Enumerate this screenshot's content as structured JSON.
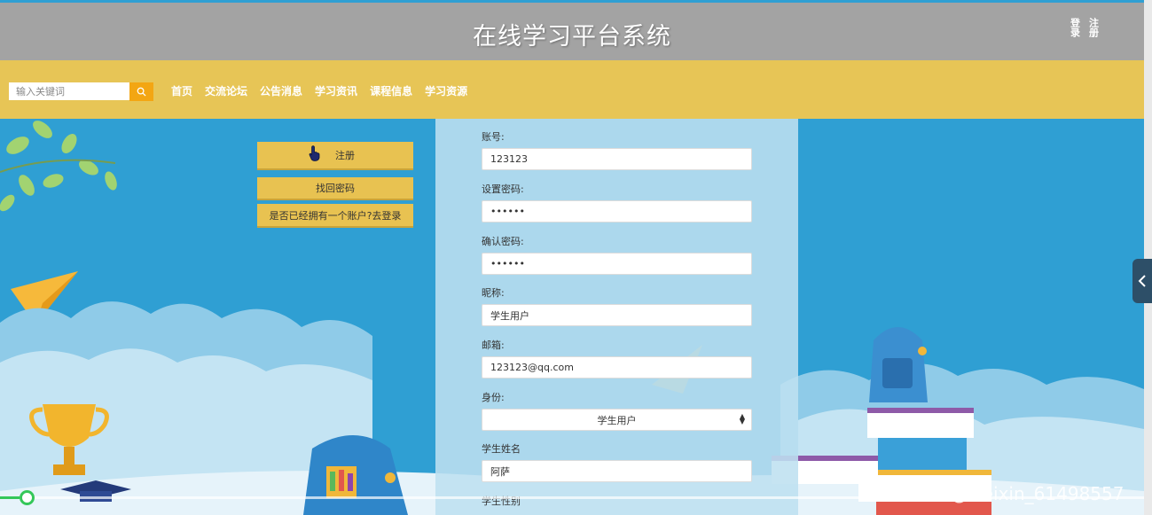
{
  "header": {
    "title": "在线学习平台系统",
    "login_label": "登录",
    "register_label": "注册"
  },
  "nav": {
    "search_placeholder": "输入关键词",
    "items": [
      "首页",
      "交流论坛",
      "公告消息",
      "学习资讯",
      "课程信息",
      "学习资源"
    ]
  },
  "actions": {
    "register": "注册",
    "forgot_password": "找回密码",
    "have_account": "是否已经拥有一个账户?去登录"
  },
  "form": {
    "account_label": "账号:",
    "account_value": "123123",
    "password_label": "设置密码:",
    "password_value": "123123",
    "confirm_label": "确认密码:",
    "confirm_value": "123123",
    "nickname_label": "昵称:",
    "nickname_value": "学生用户",
    "email_label": "邮箱:",
    "email_value": "123123@qq.com",
    "identity_label": "身份:",
    "identity_value": "学生用户",
    "student_name_label": "学生姓名",
    "student_name_value": "阿萨",
    "student_gender_label": "学生性别"
  },
  "watermark": "CSDN @weixin_61498557",
  "colors": {
    "header_bg": "#a3a3a3",
    "nav_bg": "#e7c556",
    "button_bg": "#e8c251",
    "search_btn": "#f3a613",
    "sky": "#2f9fd3"
  },
  "video_progress": 0.02
}
